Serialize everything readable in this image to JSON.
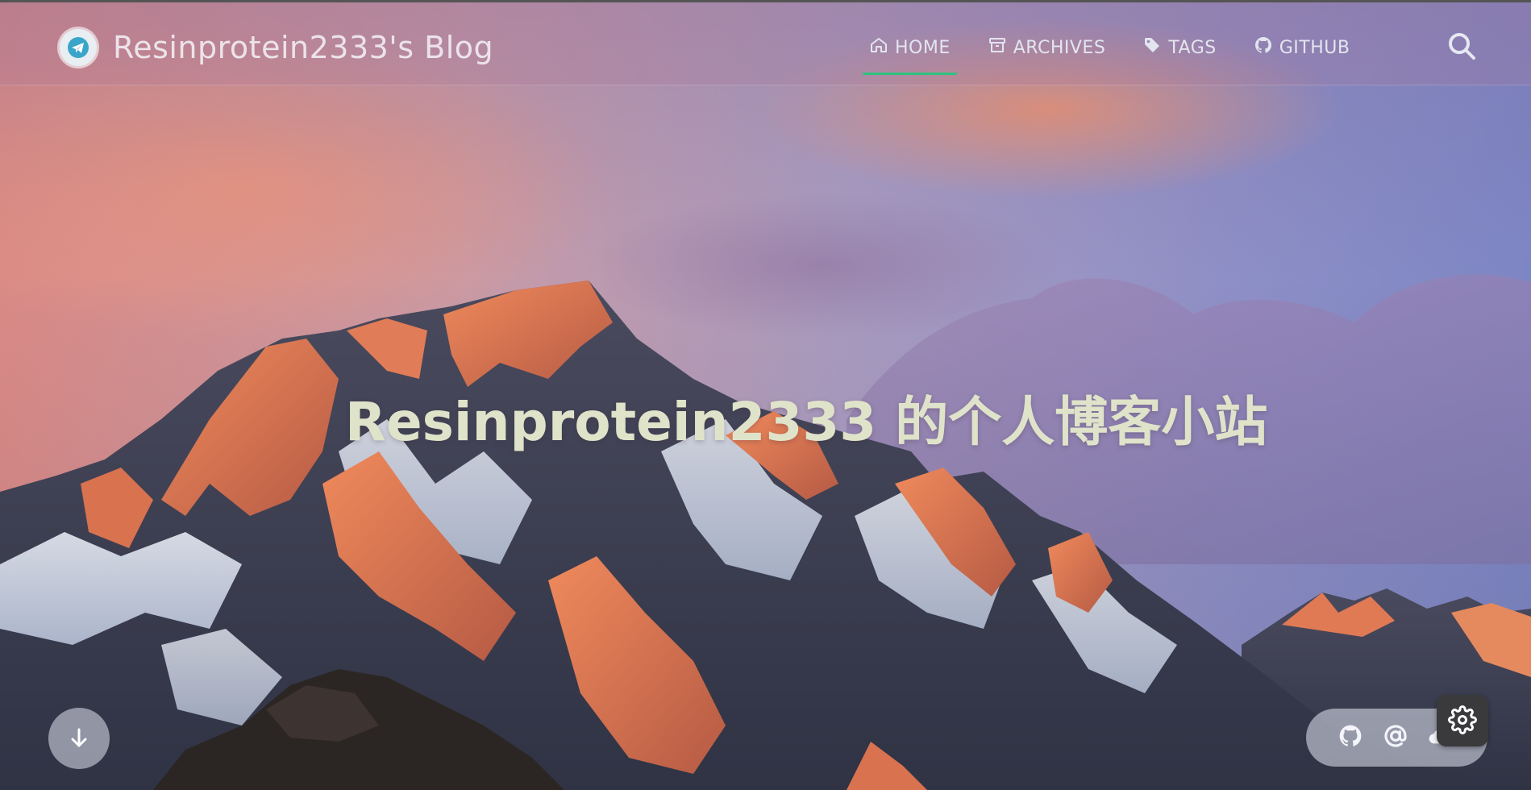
{
  "header": {
    "brand_title": "Resinprotein2333's Blog",
    "logo_icon": "telegram-avatar-icon"
  },
  "nav": {
    "items": [
      {
        "label": "HOME",
        "icon": "home-icon",
        "active": true
      },
      {
        "label": "ARCHIVES",
        "icon": "archive-icon",
        "active": false
      },
      {
        "label": "TAGS",
        "icon": "tag-icon",
        "active": false
      },
      {
        "label": "GITHUB",
        "icon": "github-icon",
        "active": false
      }
    ],
    "search_icon": "search-icon",
    "active_color": "#2ec27e"
  },
  "hero": {
    "title": "Resinprotein2333 的个人博客小站",
    "background": "mountain-sunset-image"
  },
  "controls": {
    "scroll_down_icon": "arrow-down-icon",
    "social_icons": [
      "github-icon",
      "at-email-icon",
      "cloud-icon"
    ],
    "settings_icon": "gear-icon"
  }
}
